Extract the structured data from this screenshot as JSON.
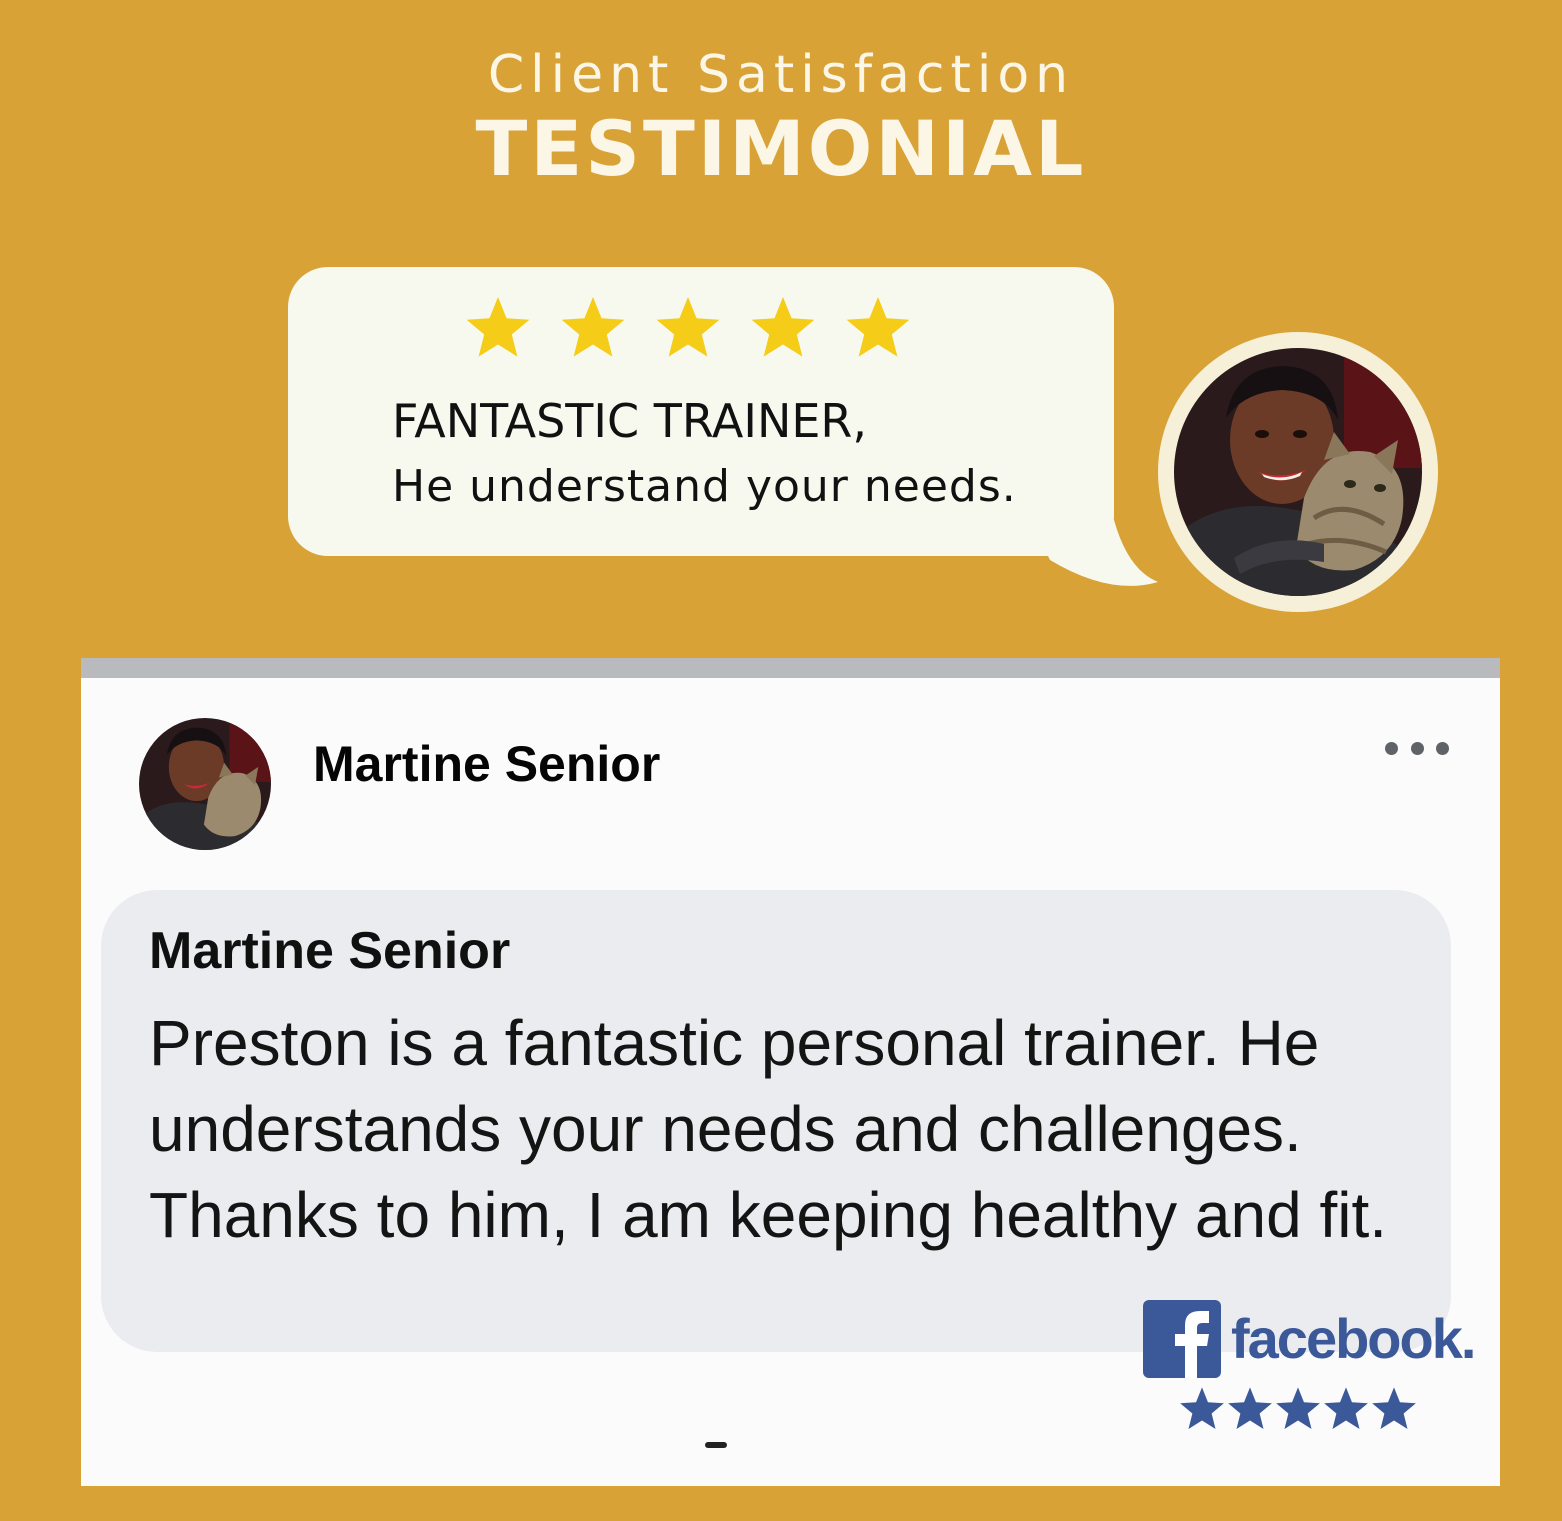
{
  "header": {
    "eyebrow": "Client Satisfaction",
    "title": "TESTIMONIAL"
  },
  "highlight": {
    "rating": 5,
    "rating_max": 5,
    "headline": "FANTASTIC TRAINER,",
    "subline": "He understand your needs."
  },
  "post": {
    "author": "Martine Senior",
    "more_icon": "more-options-icon",
    "comment": {
      "author": "Martine Senior",
      "text": "Preston is a fantastic personal trainer. He understands your needs and challenges. Thanks to him, I am keeping healthy and fit."
    },
    "badge": {
      "wordmark": "facebook.",
      "rating": 5,
      "rating_max": 5
    }
  },
  "colors": {
    "background": "#d9a236",
    "header_text": "#fbf6e6",
    "bubble": "#f7f9ef",
    "star_gold": "#f5cc18",
    "facebook_blue": "#3b5998",
    "comment_bubble": "#ebecef"
  }
}
